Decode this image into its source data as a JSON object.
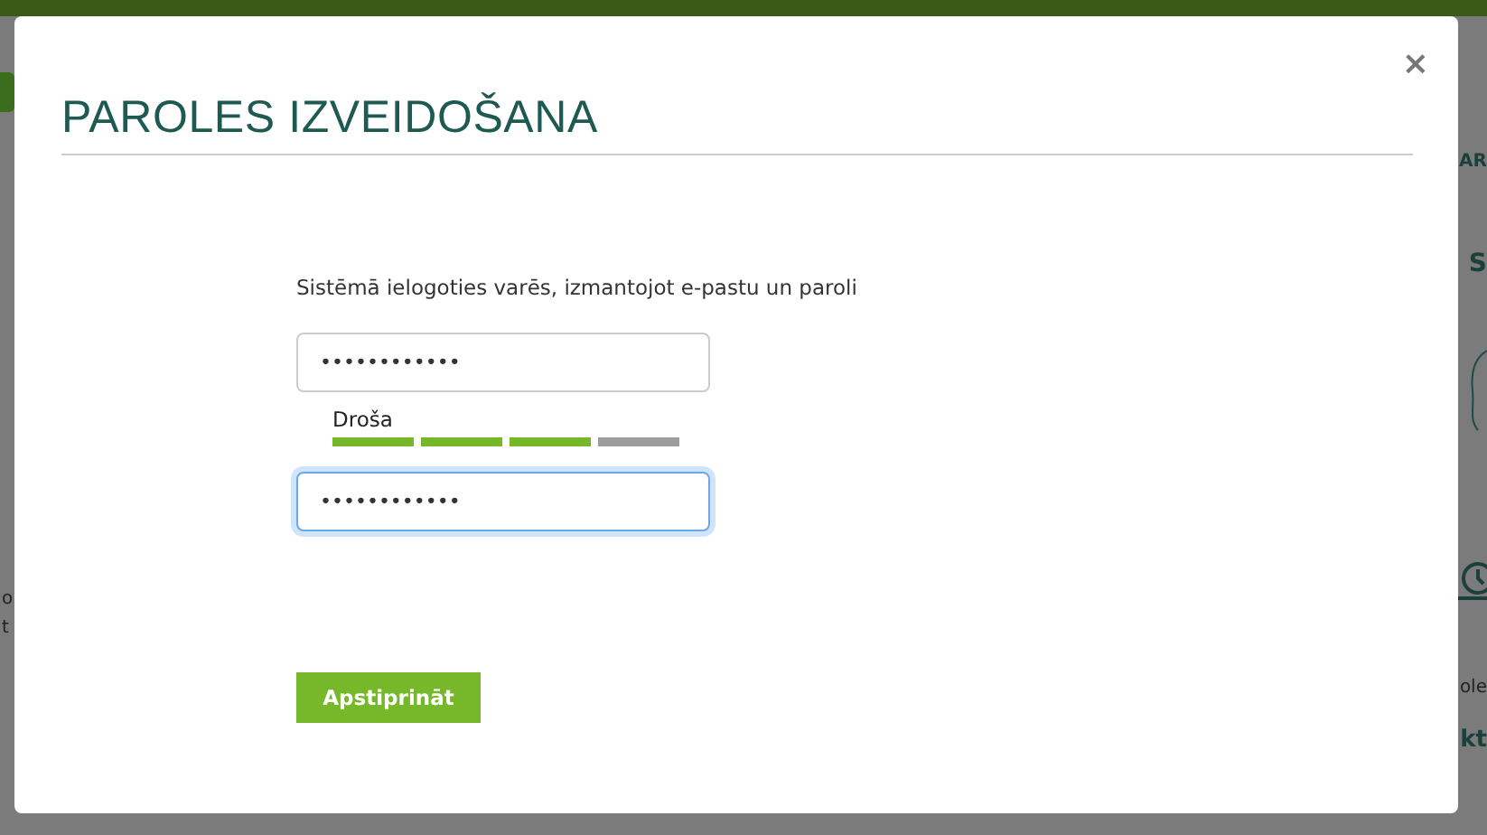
{
  "background": {
    "fragments": [
      {
        "text": "AR",
        "kind": "heading"
      },
      {
        "text": "S",
        "kind": "heading"
      },
      {
        "text": "o",
        "kind": "body"
      },
      {
        "text": "t",
        "kind": "body"
      },
      {
        "text": "ole",
        "kind": "body"
      },
      {
        "text": "kt",
        "kind": "heading"
      }
    ]
  },
  "dialog": {
    "title": "PAROLES IZVEIDOŠANA",
    "close": "×",
    "instruction": "Sistēmā ielogoties varēs, izmantojot e-pastu un paroli",
    "fields": [
      {
        "value": "••••••••••••",
        "focused": false
      },
      {
        "value": "••••••••••••",
        "focused": true
      }
    ],
    "strength": {
      "label": "Droša",
      "level": 0.75
    },
    "submit": "Apstiprināt"
  }
}
